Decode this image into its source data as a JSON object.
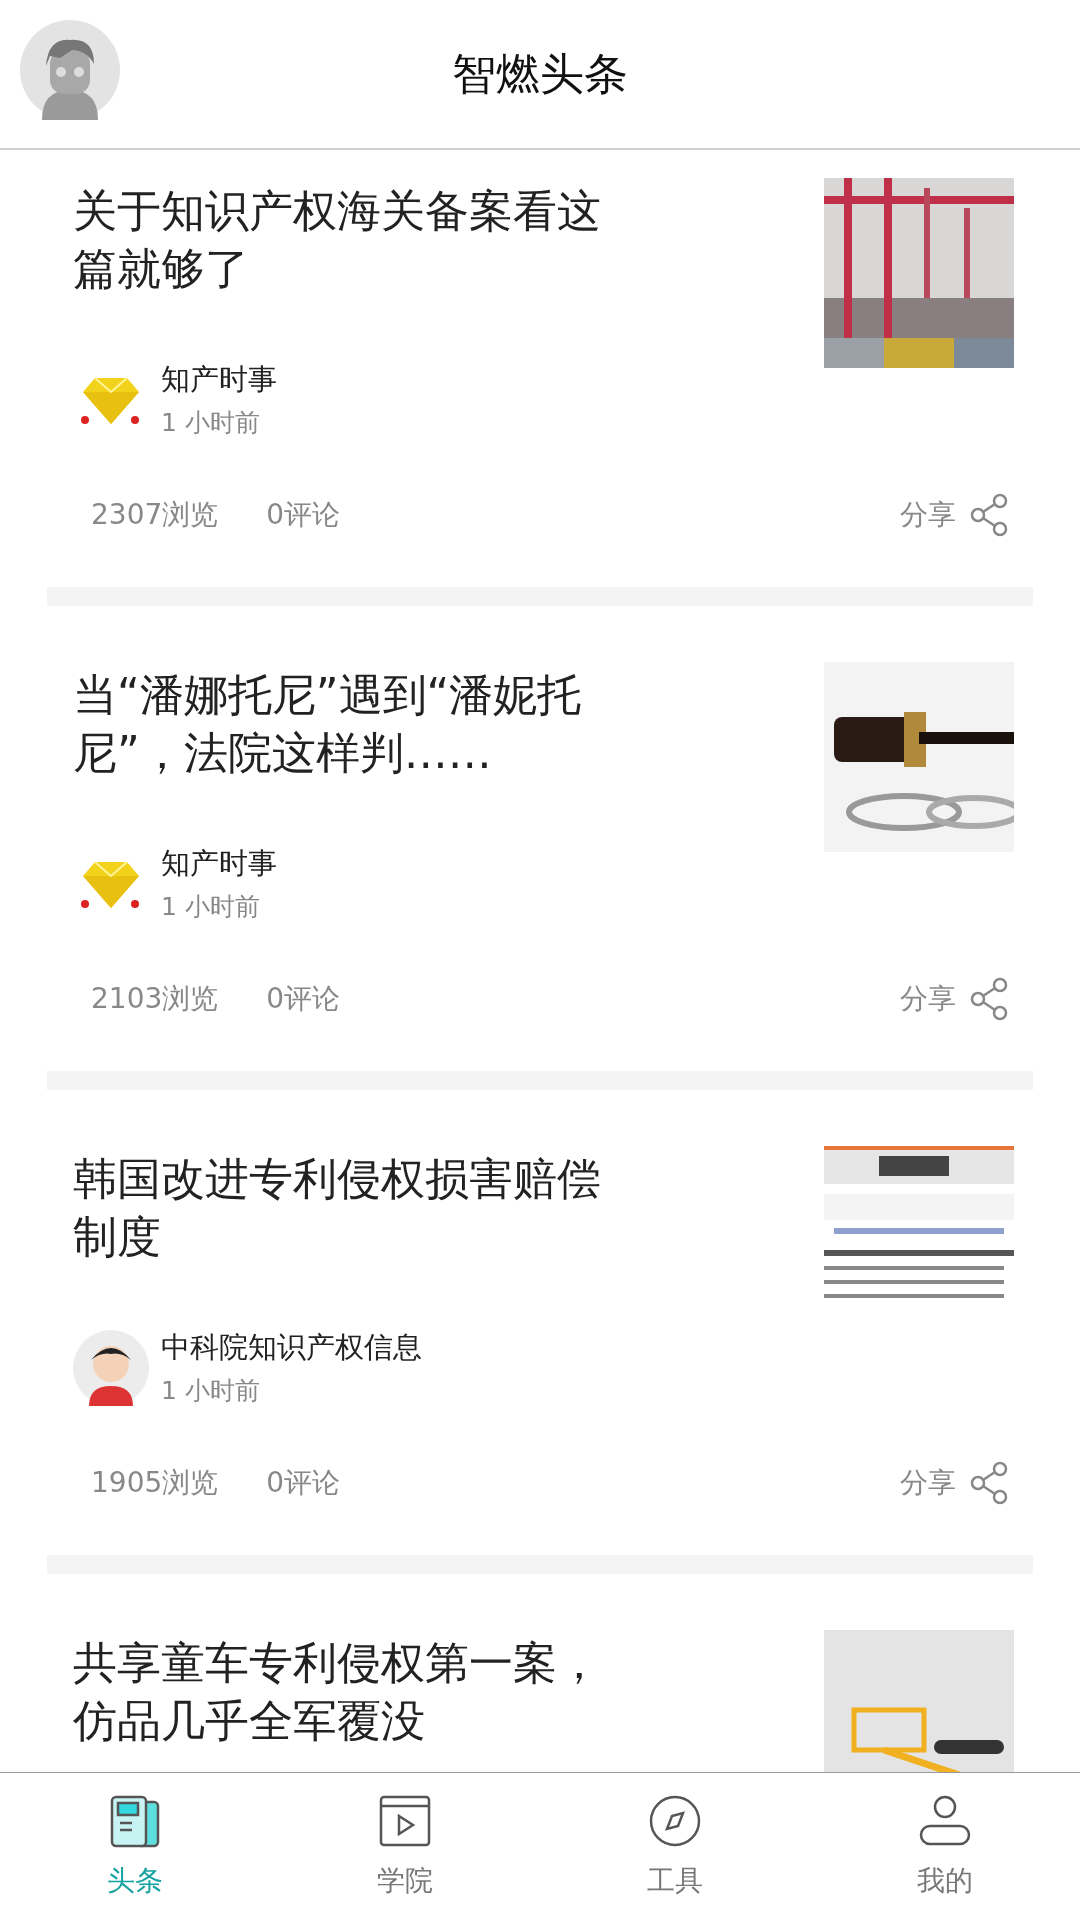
{
  "header": {
    "title": "智燃头条"
  },
  "articles": [
    {
      "title": "关于知识产权海关备案看这篇就够了",
      "author": {
        "name": "知产时事",
        "kind": "diamond"
      },
      "time": "1 小时前",
      "views": "2307浏览",
      "comments": "0评论",
      "share": "分享"
    },
    {
      "title": "当“潘娜托尼”遇到“潘妮托尼”，法院这样判……",
      "author": {
        "name": "知产时事",
        "kind": "diamond"
      },
      "time": "1 小时前",
      "views": "2103浏览",
      "comments": "0评论",
      "share": "分享"
    },
    {
      "title": "韩国改进专利侵权损害赔偿制度",
      "author": {
        "name": "中科院知识产权信息",
        "kind": "person"
      },
      "time": "1 小时前",
      "views": "1905浏览",
      "comments": "0评论",
      "share": "分享"
    },
    {
      "title": "共享童车专利侵权第一案，仿品几乎全军覆没"
    }
  ],
  "tabs": [
    {
      "label": "头条",
      "selected": true
    },
    {
      "label": "学院",
      "selected": false
    },
    {
      "label": "工具",
      "selected": false
    },
    {
      "label": "我的",
      "selected": false
    }
  ]
}
